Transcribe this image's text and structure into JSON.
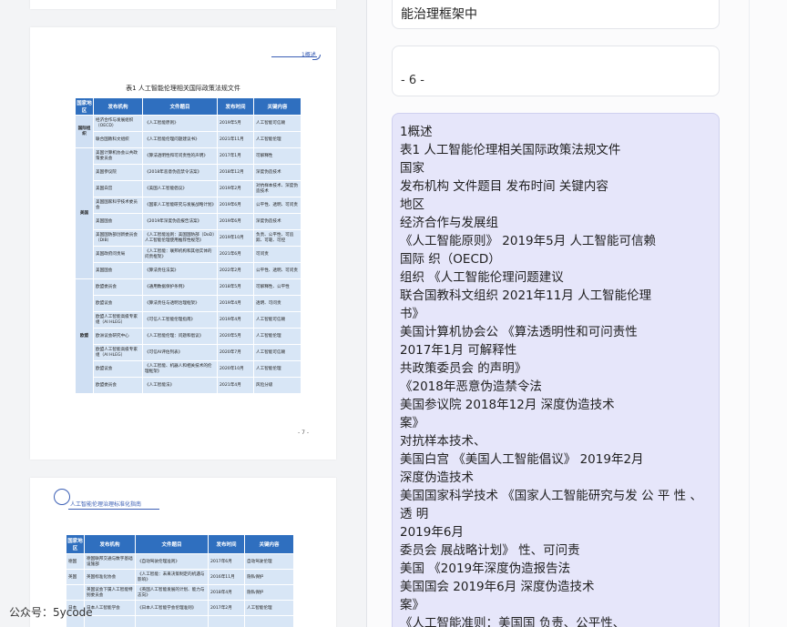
{
  "doc_page": {
    "header_tag": "1概述",
    "table_title": "表1 人工智能伦理相关国际政策法规文件",
    "columns": [
      "国家地区",
      "发布机构",
      "文件题目",
      "发布时间",
      "关键内容"
    ],
    "region_intl": "国际组织",
    "region_us": "美国",
    "region_eu": "欧盟",
    "intl_rows": [
      [
        "经济合作与发展组织（OECD）",
        "《人工智能原则》",
        "2019年5月",
        "人工智能可信赖"
      ],
      [
        "联合国教科文组织",
        "《人工智能伦理问题建议书》",
        "2021年11月",
        "人工智能伦理"
      ]
    ],
    "us_rows": [
      [
        "美国计算机协会公共政策委员会",
        "《算法透明性和可问责性的声明》",
        "2017年1月",
        "可解释性"
      ],
      [
        "美国参议院",
        "《2018年恶意伪造禁令法案》",
        "2018年12月",
        "深度伪造技术"
      ],
      [
        "美国白宫",
        "《美国人工智能倡议》",
        "2019年2月",
        "对抗样本技术、深度伪造技术"
      ],
      [
        "美国国家科学技术委员会",
        "《国家人工智能研究与发展战略计划》",
        "2019年6月",
        "公平性、透明、可问责"
      ],
      [
        "美国国会",
        "《2019年深度伪造报告法案》",
        "2019年6月",
        "深度伪造技术"
      ],
      [
        "美国国防部创新委员会（DIB）",
        "《人工智能准则：美国国防部（DoD）人工智能伦理使用推荐性规范》",
        "2019年10月",
        "负责、公平性、可追踪、可靠、可控"
      ],
      [
        "美国政府问责局",
        "《人工智能：联邦机构和其他实体的问责框架》",
        "2021年6月",
        "可问责"
      ],
      [
        "美国国会",
        "《算法责任法案》",
        "2022年2月",
        "公平性、透明、可问责"
      ]
    ],
    "eu_rows": [
      [
        "欧盟委员会",
        "《通用数据保护条例》",
        "2018年5月",
        "可解释性、公平性"
      ],
      [
        "欧盟议会",
        "《算法责任与透明治理框架》",
        "2019年4月",
        "透明、可问责"
      ],
      [
        "欧盟人工智能高级专家组（AI HLEG）",
        "《可信人工智能伦理指南》",
        "2019年4月",
        "人工智能可信赖"
      ],
      [
        "欧洲议会研究中心",
        "《人工智能伦理：问题和倡议》",
        "2020年5月",
        "人工智能伦理"
      ],
      [
        "欧盟人工智能高级专家组（AI HLEG）",
        "《可信AI评估列表》",
        "2020年7月",
        "人工智能可信赖"
      ],
      [
        "欧盟议会",
        "《人工智能、机器人和相关技术的伦理框架》",
        "2020年10月",
        "人工智能伦理"
      ],
      [
        "欧盟委员会",
        "《人工智能法》",
        "2021年4月",
        "风险分级"
      ]
    ],
    "page_number": "- 7 -"
  },
  "next_page": {
    "logo_text": "人工智能伦理治理标准化指南",
    "columns": [
      "国家地区",
      "发布机构",
      "文件题目",
      "发布时间",
      "关键内容"
    ],
    "rows": [
      [
        "德国",
        "德国联邦交通与数字基础设施部",
        "《自动驾驶伦理准则》",
        "2017年6月",
        "自动驾驶伦理"
      ],
      [
        "英国",
        "英国标准化协会",
        "《人工智能：未来决策制定的机遇与影响》",
        "2016年11月",
        "隐私保护"
      ],
      [
        "",
        "英国议会下属人工智能特别委员会",
        "《英国人工智能发展的计划、能力与志向》",
        "2018年4月",
        "隐私保护"
      ],
      [
        "日本",
        "日本人工智能学会",
        "《日本人工智能学会伦理准则》",
        "2017年2月",
        "人工智能伦理"
      ],
      [
        "",
        "",
        "",
        "",
        ""
      ]
    ]
  },
  "watermark": "公众号：5ycode",
  "chat": {
    "msg_top_tail": "能治理框架中",
    "msg_page_num": "- 6 -",
    "msg_lines": [
      "1概述",
      "表1 人工智能伦理相关国际政策法规文件",
      "国家",
      "发布机构 文件题目 发布时间 关键内容",
      "地区",
      "经济合作与发展组",
      "《人工智能原则》 2019年5月 人工智能可信赖",
      "国际 织（OECD）",
      "组织 《人工智能伦理问题建议",
      "联合国教科文组织 2021年11月 人工智能伦理",
      "书》",
      "美国计算机协会公 《算法透明性和可问责性",
      "2017年1月 可解释性",
      "共政策委员会 的声明》",
      "《2018年恶意伪造禁令法",
      "美国参议院 2018年12月 深度伪造技术",
      "案》",
      "对抗样本技术、",
      "美国白宫 《美国人工智能倡议》 2019年2月",
      "深度伪造技术",
      "美国国家科学技术 《国家人工智能研究与发 公 平 性 、",
      "透 明",
      "2019年6月",
      "委员会 展战略计划》 性、可问责",
      "美国 《2019年深度伪造报告法",
      "美国国会 2019年6月 深度伪造技术",
      "案》",
      "《人工智能准则：美国国 负责、公平性、"
    ]
  }
}
